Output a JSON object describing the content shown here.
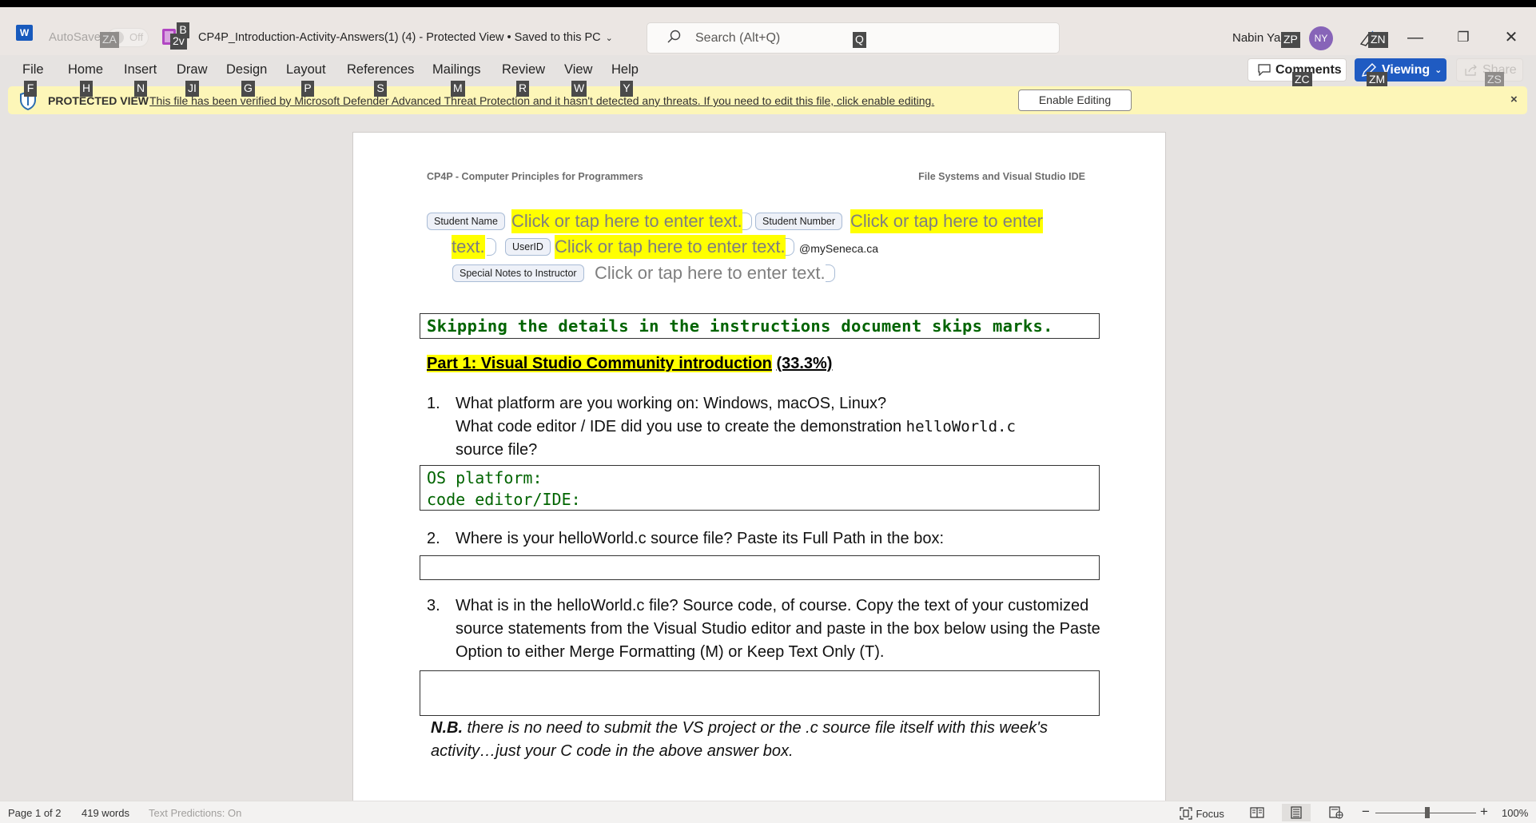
{
  "titlebar": {
    "app_icon": "word-icon",
    "autosave_label": "AutoSave",
    "autosave_state": "Off",
    "doc_title": "CP4P_Introduction-Activity-Answers(1) (4)  -  Protected View • Saved to this PC",
    "search_placeholder": "Search (Alt+Q)",
    "user_name": "Nabin Yadav",
    "user_initials": "NY",
    "minimize": "—",
    "restore": "❐",
    "close": "✕"
  },
  "ribbon": {
    "tabs": [
      {
        "label": "File",
        "key": "F"
      },
      {
        "label": "Home",
        "key": "H"
      },
      {
        "label": "Insert",
        "key": "N"
      },
      {
        "label": "Draw",
        "key": "JI"
      },
      {
        "label": "Design",
        "key": "G"
      },
      {
        "label": "Layout",
        "key": "P"
      },
      {
        "label": "References",
        "key": "S"
      },
      {
        "label": "Mailings",
        "key": "M"
      },
      {
        "label": "Review",
        "key": "R"
      },
      {
        "label": "View",
        "key": "W"
      },
      {
        "label": "Help",
        "key": "Y"
      }
    ],
    "comments_label": "Comments",
    "viewing_label": "Viewing",
    "share_label": "Share"
  },
  "keytips": {
    "autosave": "ZA",
    "save": "B",
    "save2": "2v",
    "search": "Q",
    "account": "ZP",
    "designer": "ZN",
    "comments": "ZC",
    "viewing": "ZM",
    "share": "ZS"
  },
  "protected_view": {
    "label": "PROTECTED VIEW",
    "message": "This file has been verified by Microsoft Defender Advanced Threat Protection and it hasn't detected any threats. If you need to edit this file, click enable editing.",
    "enable_button": "Enable Editing",
    "close": "×"
  },
  "document": {
    "header_left": "CP4P - Computer Principles for Programmers",
    "header_right": "File Systems and Visual Studio IDE",
    "fields": {
      "student_name_label": "Student Name",
      "student_number_label": "Student Number",
      "userid_label": "UserID",
      "notes_label": "Special Notes to Instructor",
      "placeholder": "Click or tap here to enter text.",
      "placeholder_part1": "Click or tap here to enter",
      "placeholder_part2": "text.",
      "email_suffix": "@mySeneca.ca"
    },
    "warning": "Skipping the details in the instructions document skips marks.",
    "part_title": "Part 1: Visual Studio Community introduction",
    "part_weight": "(33.3%)",
    "questions": [
      {
        "num": "1.",
        "line1": "What platform are you working on: Windows, macOS, Linux?",
        "line2_pre": "What code editor / IDE did you use to create the demonstration ",
        "line2_code": "helloWorld.c",
        "line3": "source file?"
      },
      {
        "num": "2.",
        "text": "Where is your helloWorld.c source file? Paste its Full Path in the box:"
      },
      {
        "num": "3.",
        "text": "What is in the helloWorld.c file? Source code, of course. Copy the text of your customized source statements from the Visual Studio editor and paste in the box below using the Paste Option to either Merge Formatting (M) or Keep Text Only (T)."
      }
    ],
    "answer1": [
      "OS platform:",
      "code editor/IDE:"
    ],
    "answer2": "",
    "answer3": "",
    "nb_bold": "N.B.",
    "nb_text": " there is no need to submit the VS project or the .c source file itself with this week's activity…just your C code in the above answer box."
  },
  "statusbar": {
    "page": "Page 1 of 2",
    "words": "419 words",
    "predictions": "Text Predictions: On",
    "focus": "Focus",
    "zoom_minus": "−",
    "zoom_plus": "+",
    "zoom_level": "100%"
  }
}
